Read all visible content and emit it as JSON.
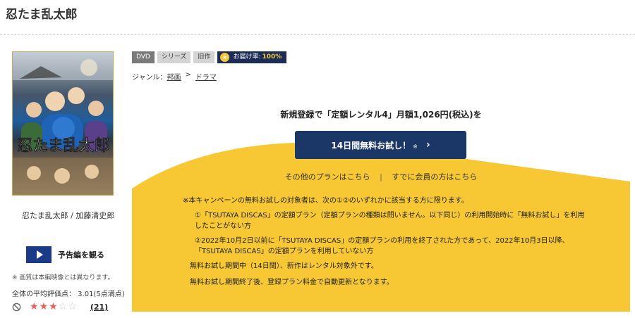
{
  "page": {
    "title": "忍たま乱太郎"
  },
  "poster": {
    "alt": "忍たま乱太郎"
  },
  "sidebar": {
    "cast": "忍たま乱太郎 / 加藤清史郎",
    "trailer_label": "予告編を観る",
    "image_note": "※ 画質は本編映像とは異なります。",
    "average_rating": "全体の平均評価点：  3.01(5点満点)",
    "stars_filled": 3,
    "stars_total": 5,
    "review_count": "(21)"
  },
  "tags": {
    "dvd": "DVD",
    "series": "シリーズ",
    "old": "旧作",
    "delivery_label": "お届け率:",
    "delivery_rate": "100%"
  },
  "genre": {
    "label": "ジャンル：",
    "level1": "邦画",
    "separator": ">",
    "level2": "ドラマ"
  },
  "campaign": {
    "headline": "新規登録で「定額レンタル4」月額1,026円(税込)を",
    "cta_label": "14日間無料お試し！",
    "cta_mark": "※",
    "other_plans": "その他のプランはこちら",
    "divider": "|",
    "member_link": "すでに会員の方はこちら",
    "terms_intro": "※本キャンペーンの無料お試しの対象者は、次の①②のいずれかに該当する方に限ります。",
    "terms_1": "①「TSUTAYA DISCAS」の定額プラン（定額プランの種類は問いません。以下同じ）の利用開始時に「無料お試し」を利用したことがない方",
    "terms_2": "②2022年10月2日以前に「TSUTAYA DISCAS」の定額プランの利用を終了された方であって、2022年10月3日以降、「TSUTAYA DISCAS」の定額プランを利用していない方",
    "terms_3": "無料お試し期間中（14日間）、新作はレンタル対象外です。",
    "terms_4": "無料お試し期間終了後、登録プラン料金で自動更新となります。"
  },
  "colors": {
    "campaign_yellow": "#f7c833",
    "navy": "#1b3768",
    "star_red": "#ef5f5a"
  }
}
